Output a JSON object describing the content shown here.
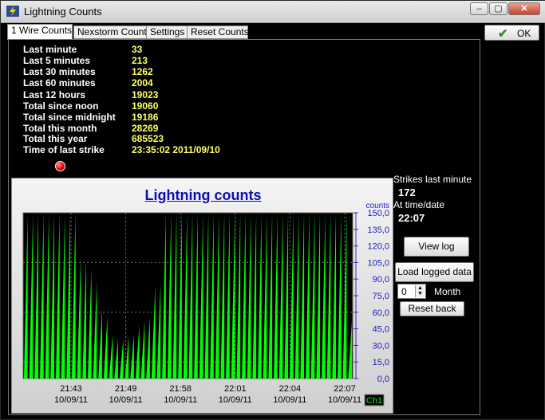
{
  "window": {
    "title": "Lightning Counts",
    "min": "–",
    "max": "▢",
    "close": "✕"
  },
  "tabs": [
    {
      "label": "1 Wire Counts",
      "active": true
    },
    {
      "label": "Nexstorm Counts"
    },
    {
      "label": "Settings"
    },
    {
      "label": "Reset Counts"
    }
  ],
  "stats": [
    {
      "label": "Last minute",
      "value": "33"
    },
    {
      "label": "Last 5 minutes",
      "value": "213"
    },
    {
      "label": "Last 30 minutes",
      "value": "1262"
    },
    {
      "label": "Last 60 minutes",
      "value": "2004"
    },
    {
      "label": "Last 12 hours",
      "value": "19023"
    },
    {
      "label": "Total since noon",
      "value": "19060"
    },
    {
      "label": "Total since midnight",
      "value": "19186"
    },
    {
      "label": "Total this month",
      "value": "28269"
    },
    {
      "label": "Total this year",
      "value": "685523"
    },
    {
      "label": "Time of last strike",
      "value": "23:35:02 2011/09/10"
    }
  ],
  "right_panel": {
    "strikes_label": "Strikes last minute",
    "strikes_value": "172",
    "at_label": "At time/date",
    "at_value": "22:07",
    "view_log": "View log",
    "load_logged": "Load logged data",
    "month_value": "0",
    "month_label": "Month",
    "reset_back": "Reset back"
  },
  "ok_button": {
    "label": "OK"
  },
  "chart_data": {
    "type": "area",
    "title": "Lightning counts",
    "ylabel": "counts",
    "ylim": [
      0,
      150
    ],
    "yticks": [
      "0,0",
      "15,0",
      "30,0",
      "45,0",
      "60,0",
      "75,0",
      "90,0",
      "105,0",
      "120,0",
      "135,0",
      "150,0"
    ],
    "xticks": [
      {
        "time": "21:43",
        "date": "10/09/11"
      },
      {
        "time": "21:49",
        "date": "10/09/11"
      },
      {
        "time": "21:58",
        "date": "10/09/11"
      },
      {
        "time": "22:01",
        "date": "10/09/11"
      },
      {
        "time": "22:04",
        "date": "10/09/11"
      },
      {
        "time": "22:07",
        "date": "10/09/11"
      }
    ],
    "channel": "Ch1",
    "series_color": "#00ff00",
    "background": "#000000",
    "peaks": [
      148,
      150,
      150,
      150,
      150,
      150,
      150,
      150,
      150,
      150,
      112,
      108,
      100,
      88,
      64,
      56,
      40,
      36,
      36,
      38,
      40,
      48,
      52,
      56,
      84,
      86,
      150,
      150,
      150,
      150,
      150,
      150,
      150,
      150,
      150,
      150,
      150,
      150,
      150,
      150,
      150,
      150,
      150,
      150,
      150,
      150,
      150,
      150,
      150,
      150,
      150,
      150,
      150,
      150,
      150,
      150,
      150,
      150,
      150,
      150,
      150,
      52
    ]
  }
}
